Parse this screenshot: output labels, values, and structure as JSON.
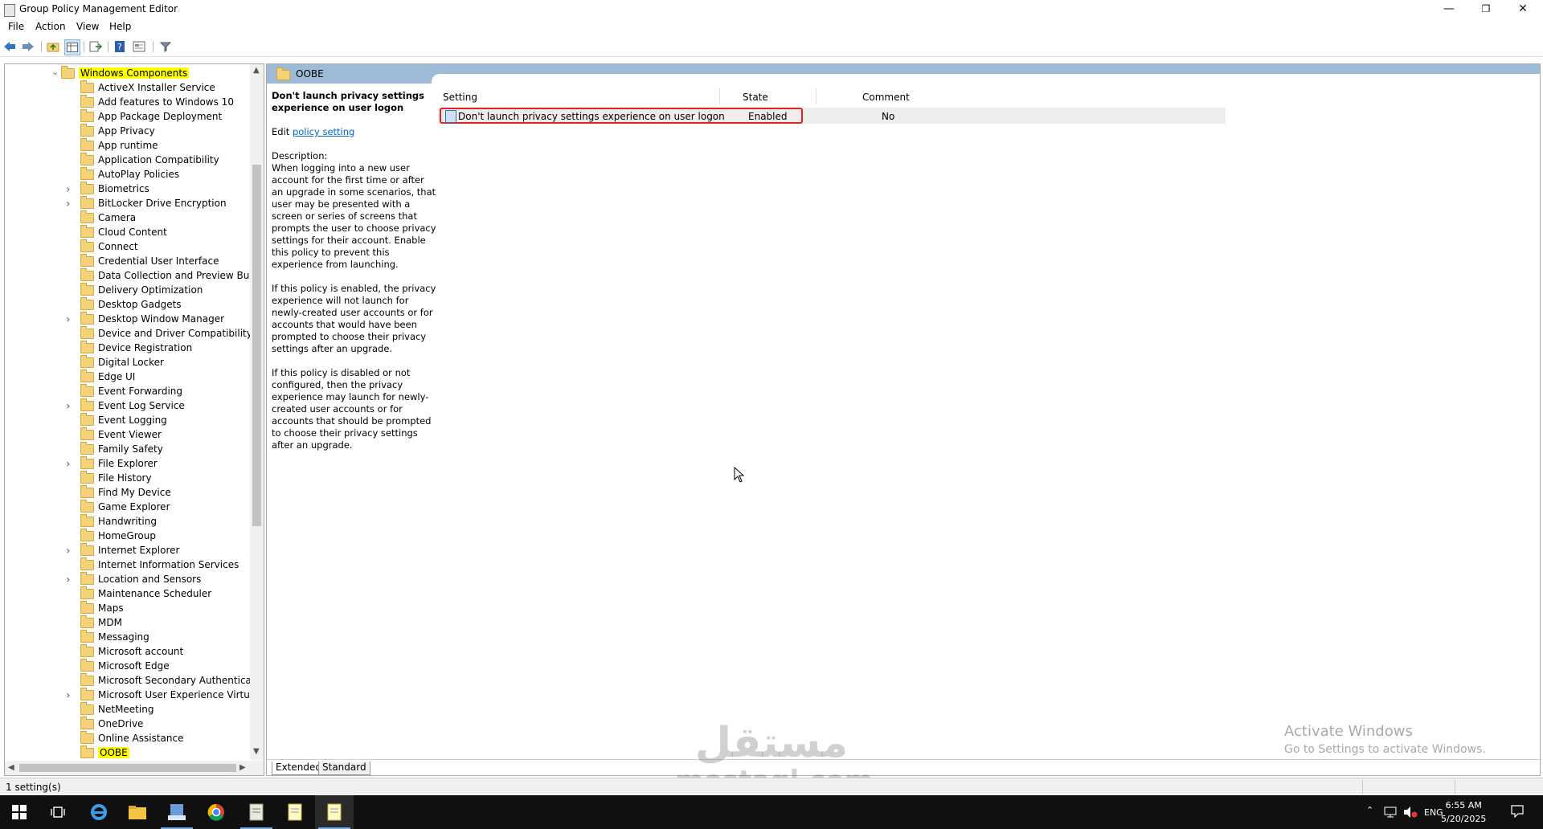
{
  "window": {
    "title": "Group Policy Management Editor",
    "controls": {
      "minimize": "—",
      "restore": "❐",
      "close": "✕"
    }
  },
  "menu": [
    "File",
    "Action",
    "View",
    "Help"
  ],
  "toolbar": {
    "icons": [
      "back-arrow-icon",
      "forward-arrow-icon",
      "folder-up-icon",
      "show-hide-tree-icon",
      "export-list-icon",
      "help-icon",
      "properties-icon",
      "filter-icon"
    ]
  },
  "tree": {
    "root": "Windows Components",
    "items": [
      {
        "label": "ActiveX Installer Service",
        "expandable": false
      },
      {
        "label": "Add features to Windows 10",
        "expandable": false
      },
      {
        "label": "App Package Deployment",
        "expandable": false
      },
      {
        "label": "App Privacy",
        "expandable": false
      },
      {
        "label": "App runtime",
        "expandable": false
      },
      {
        "label": "Application Compatibility",
        "expandable": false
      },
      {
        "label": "AutoPlay Policies",
        "expandable": false
      },
      {
        "label": "Biometrics",
        "expandable": true
      },
      {
        "label": "BitLocker Drive Encryption",
        "expandable": true
      },
      {
        "label": "Camera",
        "expandable": false
      },
      {
        "label": "Cloud Content",
        "expandable": false
      },
      {
        "label": "Connect",
        "expandable": false
      },
      {
        "label": "Credential User Interface",
        "expandable": false
      },
      {
        "label": "Data Collection and Preview Builds",
        "expandable": false
      },
      {
        "label": "Delivery Optimization",
        "expandable": false
      },
      {
        "label": "Desktop Gadgets",
        "expandable": false
      },
      {
        "label": "Desktop Window Manager",
        "expandable": true
      },
      {
        "label": "Device and Driver Compatibility",
        "expandable": false
      },
      {
        "label": "Device Registration",
        "expandable": false
      },
      {
        "label": "Digital Locker",
        "expandable": false
      },
      {
        "label": "Edge UI",
        "expandable": false
      },
      {
        "label": "Event Forwarding",
        "expandable": false
      },
      {
        "label": "Event Log Service",
        "expandable": true
      },
      {
        "label": "Event Logging",
        "expandable": false
      },
      {
        "label": "Event Viewer",
        "expandable": false
      },
      {
        "label": "Family Safety",
        "expandable": false
      },
      {
        "label": "File Explorer",
        "expandable": true
      },
      {
        "label": "File History",
        "expandable": false
      },
      {
        "label": "Find My Device",
        "expandable": false
      },
      {
        "label": "Game Explorer",
        "expandable": false
      },
      {
        "label": "Handwriting",
        "expandable": false
      },
      {
        "label": "HomeGroup",
        "expandable": false
      },
      {
        "label": "Internet Explorer",
        "expandable": true
      },
      {
        "label": "Internet Information Services",
        "expandable": false
      },
      {
        "label": "Location and Sensors",
        "expandable": true
      },
      {
        "label": "Maintenance Scheduler",
        "expandable": false
      },
      {
        "label": "Maps",
        "expandable": false
      },
      {
        "label": "MDM",
        "expandable": false
      },
      {
        "label": "Messaging",
        "expandable": false
      },
      {
        "label": "Microsoft account",
        "expandable": false
      },
      {
        "label": "Microsoft Edge",
        "expandable": false
      },
      {
        "label": "Microsoft Secondary Authenticatio",
        "expandable": false
      },
      {
        "label": "Microsoft User Experience Virtualiz",
        "expandable": true
      },
      {
        "label": "NetMeeting",
        "expandable": false
      },
      {
        "label": "OneDrive",
        "expandable": false
      },
      {
        "label": "Online Assistance",
        "expandable": false
      },
      {
        "label": "OOBE",
        "expandable": false,
        "selected": true
      }
    ]
  },
  "details": {
    "header_title": "OOBE",
    "policy_title": "Don't launch privacy settings experience on user logon",
    "edit_prefix": "Edit",
    "edit_link": "policy setting",
    "description_label": "Description:",
    "paragraphs": [
      "When logging into a new user account for the first time or after an upgrade in some scenarios, that user may be presented with a screen or series of screens that prompts the user to choose privacy settings for their account. Enable this policy to prevent this experience from launching.",
      "If this policy is enabled, the privacy experience will not launch for newly-created user accounts or for accounts that would have been prompted to choose their privacy settings after an upgrade.",
      "If this policy is disabled or not configured, then the privacy experience may launch for newly-created user accounts or for accounts that should be prompted to choose their privacy settings after an upgrade."
    ]
  },
  "table": {
    "columns": [
      "Setting",
      "State",
      "Comment"
    ],
    "rows": [
      {
        "setting": "Don't launch privacy settings experience on user logon",
        "state": "Enabled",
        "comment": "No"
      }
    ]
  },
  "tabs": [
    "Extended",
    "Standard"
  ],
  "status": "1 setting(s)",
  "activation": {
    "line1": "Activate Windows",
    "line2": "Go to Settings to activate Windows."
  },
  "watermark": {
    "logo": "مستقل",
    "site": "mostaql.com"
  },
  "taskbar": {
    "language": "ENG",
    "time": "6:55 AM",
    "date": "5/20/2025"
  }
}
